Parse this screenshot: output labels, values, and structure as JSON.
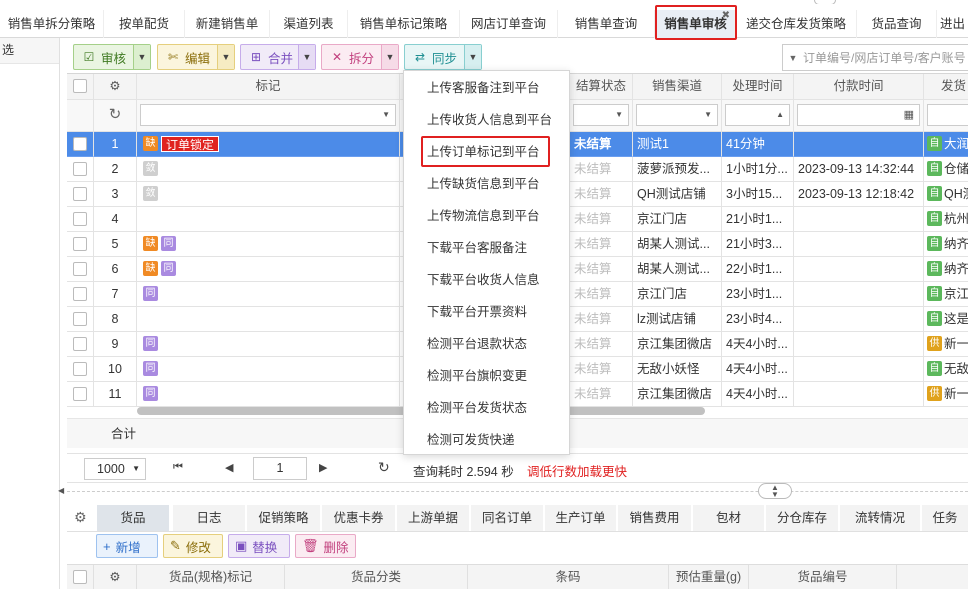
{
  "tabs": [
    {
      "label": "销售单拆分策略"
    },
    {
      "label": "按单配货"
    },
    {
      "label": "新建销售单"
    },
    {
      "label": "渠道列表"
    },
    {
      "label": "销售单标记策略"
    },
    {
      "label": "网店订单查询"
    },
    {
      "label": "销售单查询"
    },
    {
      "label": "销售单审核",
      "active": true
    },
    {
      "label": "递交仓库发货策略"
    },
    {
      "label": "货品查询"
    },
    {
      "label": "进出"
    }
  ],
  "left_panel": {
    "filter_label": "选"
  },
  "toolbar": {
    "review": "审核",
    "edit": "编辑",
    "merge": "合并",
    "split": "拆分",
    "sync": "同步"
  },
  "search": {
    "placeholder": "订单编号/网店订单号/客户账号"
  },
  "columns": {
    "mark": "标记",
    "settle_status": "结算状态",
    "channel": "销售渠道",
    "process_time": "处理时间",
    "pay_time": "付款时间",
    "ship": "发货"
  },
  "rows": [
    {
      "no": "1",
      "tags": [
        "缺"
      ],
      "lock": "订单锁定",
      "settle": "未结算",
      "channel": "测试1",
      "time": "41分钟",
      "pay": "",
      "wh_tag": "自",
      "wh": "大润"
    },
    {
      "no": "2",
      "tags": [
        "敛"
      ],
      "lock": "",
      "settle": "未结算",
      "channel": "菠萝派预发...",
      "time": "1小时1分...",
      "pay": "2023-09-13 14:32:44",
      "wh_tag": "自",
      "wh": "仓储"
    },
    {
      "no": "3",
      "tags": [
        "敛"
      ],
      "lock": "",
      "settle": "未结算",
      "channel": "QH测试店铺",
      "time": "3小时15...",
      "pay": "2023-09-13 12:18:42",
      "wh_tag": "自",
      "wh": "QH测"
    },
    {
      "no": "4",
      "tags": [],
      "lock": "",
      "settle": "未结算",
      "channel": "京江门店",
      "time": "21小时1...",
      "pay": "",
      "wh_tag": "自",
      "wh": "杭州"
    },
    {
      "no": "5",
      "tags": [
        "缺",
        "同"
      ],
      "lock": "",
      "settle": "未结算",
      "channel": "胡某人测试...",
      "time": "21小时3...",
      "pay": "",
      "wh_tag": "自",
      "wh": "纳齐"
    },
    {
      "no": "6",
      "tags": [
        "缺",
        "同"
      ],
      "lock": "",
      "settle": "未结算",
      "channel": "胡某人测试...",
      "time": "22小时1...",
      "pay": "",
      "wh_tag": "自",
      "wh": "纳齐"
    },
    {
      "no": "7",
      "tags": [
        "同"
      ],
      "lock": "",
      "settle": "未结算",
      "channel": "京江门店",
      "time": "23小时1...",
      "pay": "",
      "wh_tag": "自",
      "wh": "京江"
    },
    {
      "no": "8",
      "tags": [],
      "lock": "",
      "settle": "未结算",
      "channel": "lz测试店铺",
      "time": "23小时4...",
      "pay": "",
      "wh_tag": "自",
      "wh": "这是"
    },
    {
      "no": "9",
      "tags": [
        "同"
      ],
      "lock": "",
      "settle": "未结算",
      "channel": "京江集团微店",
      "time": "4天4小时...",
      "pay": "",
      "wh_tag": "供",
      "wh": "新一"
    },
    {
      "no": "10",
      "tags": [
        "同"
      ],
      "lock": "",
      "settle": "未结算",
      "channel": "无敌小妖怪",
      "time": "4天4小时...",
      "pay": "",
      "wh_tag": "自",
      "wh": "无敌"
    },
    {
      "no": "11",
      "tags": [
        "同"
      ],
      "lock": "",
      "settle": "未结算",
      "channel": "京江集团微店",
      "time": "4天4小时...",
      "pay": "",
      "wh_tag": "供",
      "wh": "新一"
    }
  ],
  "summary": {
    "total_label": "合计"
  },
  "pager": {
    "page_size": "1000",
    "page": "1",
    "query_time": "查询耗时 2.594 秒",
    "hint": "调低行数加载更快"
  },
  "sync_menu": [
    "上传客服备注到平台",
    "上传收货人信息到平台",
    "上传订单标记到平台",
    "上传缺货信息到平台",
    "上传物流信息到平台",
    "下载平台客服备注",
    "下载平台收货人信息",
    "下载平台开票资料",
    "检测平台退款状态",
    "检测平台旗帜变更",
    "检测平台发货状态",
    "检测可发货快递"
  ],
  "bottom_tabs": [
    "货品",
    "日志",
    "促销策略",
    "优惠卡券",
    "上游单据",
    "同名订单",
    "生产订单",
    "销售费用",
    "包材",
    "分仓库存",
    "流转情况",
    "任务"
  ],
  "bottom_toolbar": {
    "add": "新增",
    "modify": "修改",
    "replace": "替换",
    "delete": "删除"
  },
  "detail_columns": [
    "货品(规格)标记",
    "货品分类",
    "条码",
    "预估重量(g)",
    "货品编号"
  ],
  "colors": {
    "selected_row": "#4c8be8",
    "highlight_box": "#e02020",
    "unsettled": "#e02020"
  }
}
